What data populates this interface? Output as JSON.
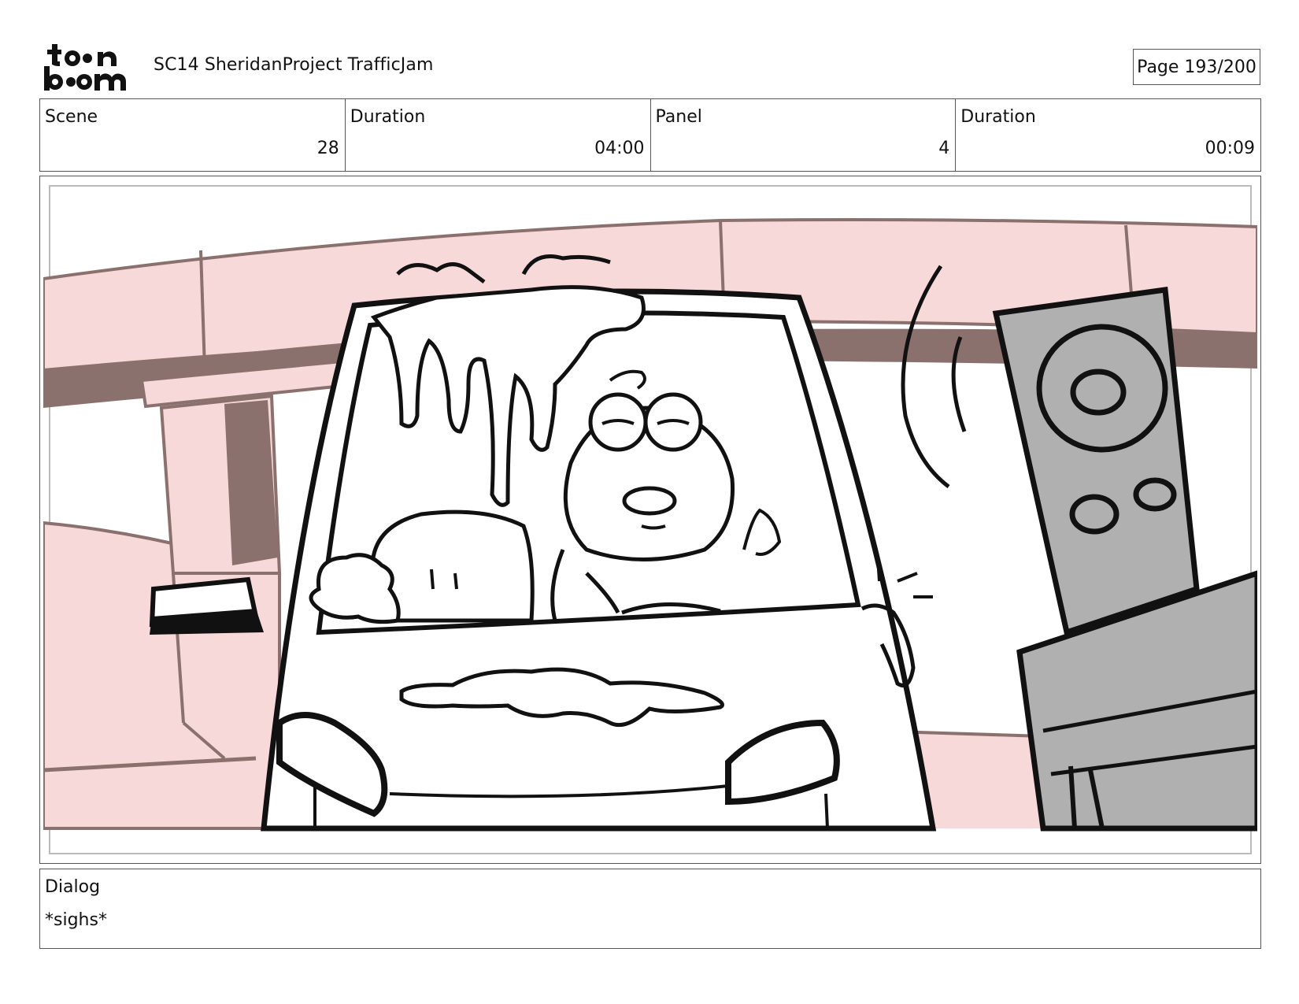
{
  "header": {
    "logo_text": "toon boom",
    "project_title": "SC14 SheridanProject TrafficJam",
    "page_indicator": "Page 193/200"
  },
  "info": [
    {
      "label": "Scene",
      "value": "28"
    },
    {
      "label": "Duration",
      "value": "04:00"
    },
    {
      "label": "Panel",
      "value": "4"
    },
    {
      "label": "Duration",
      "value": "00:09"
    }
  ],
  "dialog": {
    "label": "Dialog",
    "text": "*sighs*"
  },
  "colors": {
    "sky_pink": "#f8d9d9",
    "bridge_brown": "#8a716e",
    "speaker_gray": "#b0b0b0",
    "line": "#111111"
  }
}
